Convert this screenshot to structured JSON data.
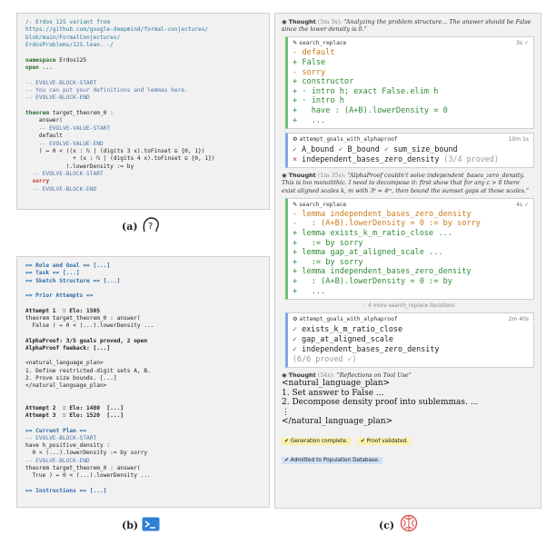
{
  "panel_a": {
    "caption": "(a)",
    "lines": [
      [
        {
          "t": "/- Erdos 125 variant from",
          "c": "c-comment"
        }
      ],
      [
        {
          "t": "https://github.com/google-deepmind/formal-conjectures/",
          "c": "c-comment"
        }
      ],
      [
        {
          "t": "blob/main/FormalConjectures/",
          "c": "c-comment"
        }
      ],
      [
        {
          "t": "ErdosProblems/125.lean. -/",
          "c": "c-comment"
        }
      ],
      [
        {
          "t": "",
          "c": ""
        }
      ],
      [
        {
          "t": "namespace",
          "c": "c-kw"
        },
        {
          "t": " Erdos125",
          "c": ""
        }
      ],
      [
        {
          "t": "open ...",
          "c": "c-kw"
        }
      ],
      [
        {
          "t": "",
          "c": ""
        }
      ],
      [
        {
          "t": "-- EVOLVE-BLOCK-START",
          "c": "c-block"
        }
      ],
      [
        {
          "t": "-- You can put your definitions and lemmas here.",
          "c": "c-block"
        }
      ],
      [
        {
          "t": "-- EVOLVE-BLOCK-END",
          "c": "c-block"
        }
      ],
      [
        {
          "t": "",
          "c": ""
        }
      ],
      [
        {
          "t": "theorem",
          "c": "c-kw"
        },
        {
          "t": " target_theorem_0 :",
          "c": ""
        }
      ],
      [
        {
          "t": "    answer(",
          "c": ""
        }
      ],
      [
        {
          "t": "    -- EVOLVE-VALUE-START",
          "c": "c-block"
        }
      ],
      [
        {
          "t": "    default",
          "c": ""
        }
      ],
      [
        {
          "t": "    -- EVOLVE-VALUE-END",
          "c": "c-block"
        }
      ],
      [
        {
          "t": "    ) ↔ 0 < ((x : ℕ | (digits 3 x).toFinset ⊆ {0, 1})",
          "c": ""
        }
      ],
      [
        {
          "t": "              + (x : ℕ | (digits 4 x).toFinset ⊆ {0, 1})",
          "c": ""
        }
      ],
      [
        {
          "t": "            ).lowerDensity := by",
          "c": ""
        }
      ],
      [
        {
          "t": "  -- EVOLVE-BLOCK-START",
          "c": "c-block"
        }
      ],
      [
        {
          "t": "  sorry",
          "c": "c-red"
        }
      ],
      [
        {
          "t": "  -- EVOLVE-BLOCK-END",
          "c": "c-block"
        }
      ]
    ]
  },
  "panel_b": {
    "caption": "(b)",
    "lines": [
      [
        {
          "t": "== Role and Goal == [...]",
          "c": "c-head"
        }
      ],
      [
        {
          "t": "== Task == [...]",
          "c": "c-head"
        }
      ],
      [
        {
          "t": "== Sketch Structure == [...]",
          "c": "c-head"
        }
      ],
      [
        {
          "t": "",
          "c": ""
        }
      ],
      [
        {
          "t": "== Prior Attempts ==",
          "c": "c-head"
        }
      ],
      [
        {
          "t": "",
          "c": ""
        }
      ],
      [
        {
          "t": "Attempt 1  ♖ Elo: 1505",
          "c": "c-bold"
        }
      ],
      [
        {
          "t": "theorem target_theorem_0 : answer(",
          "c": ""
        }
      ],
      [
        {
          "t": "  False ) ↔ 0 < (...).lowerDensity ...",
          "c": ""
        }
      ],
      [
        {
          "t": "",
          "c": ""
        }
      ],
      [
        {
          "t": "AlphaProof: 3/5 goals proved, 2 open",
          "c": "c-bold"
        }
      ],
      [
        {
          "t": "AlphaProof feeback: [...]",
          "c": "c-bold"
        }
      ],
      [
        {
          "t": "",
          "c": ""
        }
      ],
      [
        {
          "t": "<natural_language_plan>",
          "c": ""
        }
      ],
      [
        {
          "t": "1. Define restricted-digit sets A, B.",
          "c": ""
        }
      ],
      [
        {
          "t": "2. Prove size bounds. [...]",
          "c": ""
        }
      ],
      [
        {
          "t": "</natural_language_plan>",
          "c": ""
        }
      ],
      [
        {
          "t": "",
          "c": ""
        }
      ],
      [
        {
          "t": "",
          "c": ""
        }
      ],
      [
        {
          "t": "Attempt 2  ♖ Elo: 1480  [...]",
          "c": "c-bold"
        }
      ],
      [
        {
          "t": "Attempt 3  ♖ Elo: 1520  [...]",
          "c": "c-bold"
        }
      ],
      [
        {
          "t": "",
          "c": ""
        }
      ],
      [
        {
          "t": "== Current Plan ==",
          "c": "c-head"
        }
      ],
      [
        {
          "t": "-- EVOLVE-BLOCK-START",
          "c": "c-block"
        }
      ],
      [
        {
          "t": "have h_positive_density :",
          "c": ""
        }
      ],
      [
        {
          "t": "  0 < (...).lowerDensity := by sorry",
          "c": ""
        }
      ],
      [
        {
          "t": "-- EVOLVE-BLOCK-END",
          "c": "c-block"
        }
      ],
      [
        {
          "t": "theorem target_theorem_0 : answer(",
          "c": ""
        }
      ],
      [
        {
          "t": "  True ) ↔ 0 < (...).lowerDensity ...",
          "c": ""
        }
      ],
      [
        {
          "t": "",
          "c": ""
        }
      ],
      [
        {
          "t": "== Instructions == [...]",
          "c": "c-head"
        }
      ]
    ]
  },
  "panel_c": {
    "caption": "(c)",
    "thought1": {
      "label": "Thought",
      "time": "(5m 3s):",
      "text": "“Analyzing the problem structure... The answer should be False since the lower density is 0.”"
    },
    "tool1": {
      "name": "search_replace",
      "time": "3s ✓",
      "lines": [
        {
          "t": "- default",
          "c": "c-del"
        },
        {
          "t": "+ False",
          "c": "c-add"
        },
        {
          "t": "- sorry",
          "c": "c-del"
        },
        {
          "t": "+ constructor",
          "c": "c-add"
        },
        {
          "t": "+ · intro h; exact False.elim h",
          "c": "c-add"
        },
        {
          "t": "+ · intro h",
          "c": "c-add"
        },
        {
          "t": "+   have : (A+B).lowerDensity = 0",
          "c": "c-add"
        },
        {
          "t": "+   ...",
          "c": "c-add"
        }
      ]
    },
    "tool2": {
      "name": "attempt_goals_with_alphaproof",
      "time": "10m 1s",
      "row1": [
        {
          "m": "✓",
          "t": "A_bound"
        },
        {
          "m": "✓",
          "t": "B_bound"
        },
        {
          "m": "✓",
          "t": "sum_size_bound"
        }
      ],
      "row2": {
        "m": "×",
        "t": "independent_bases_zero_density",
        "count": "(3/4 proved)"
      }
    },
    "thought2": {
      "label": "Thought",
      "time": "(1m 35s):",
      "text": "“AlphaProof couldn’t solve independent_bases_zero_density. This is too monolithic. I need to decompose it: first show that for any ε > 0 there exist aligned scales k, m with 3ᵏ ≈ 4ᵐ, then bound the sumset gaps at those scales.”"
    },
    "tool3": {
      "name": "search_replace",
      "time": "4s ✓",
      "lines": [
        {
          "t": "- lemma independent_bases_zero_density",
          "c": "c-del"
        },
        {
          "t": "-   : (A+B).lowerDensity = 0 := by sorry",
          "c": "c-del"
        },
        {
          "t": "+ lemma exists_k_m_ratio_close ...",
          "c": "c-add"
        },
        {
          "t": "+   := by sorry",
          "c": "c-add"
        },
        {
          "t": "+ lemma gap_at_aligned_scale ...",
          "c": "c-add"
        },
        {
          "t": "+   := by sorry",
          "c": "c-add"
        },
        {
          "t": "+ lemma independent_bases_zero_density",
          "c": "c-add"
        },
        {
          "t": "+   : (A+B).lowerDensity = 0 := by",
          "c": "c-add"
        },
        {
          "t": "+   ...",
          "c": "c-add"
        }
      ]
    },
    "more": "⋮ 4 more search_replace iterations",
    "tool4": {
      "name": "attempt_goals_with_alphaproof",
      "time": "2m 40s",
      "goals": [
        "exists_k_m_ratio_close",
        "gap_at_aligned_scale",
        "independent_bases_zero_density"
      ],
      "count": "(6/6 proved ✓)"
    },
    "thought3": {
      "label": "Thought",
      "time": "(54s):",
      "text": "“Reflections on Tool Use”"
    },
    "plan": [
      "<natural_language_plan>",
      "1. Set answer to False ...",
      "2. Decompose density proof into sublemmas. ...",
      "⋮",
      "</natural_language_plan>"
    ],
    "badges": [
      "✔ Generation complete.",
      "✔ Proof validated."
    ],
    "admitted": "✔ Admitted to Population Database."
  },
  "colors": {
    "check": "#2f8a34",
    "cross": "#c0392b",
    "add": "#2f8a34",
    "del": "#cc7a1a",
    "terminal_icon": "#2f7fd6",
    "brain_icon": "#d9534f"
  }
}
